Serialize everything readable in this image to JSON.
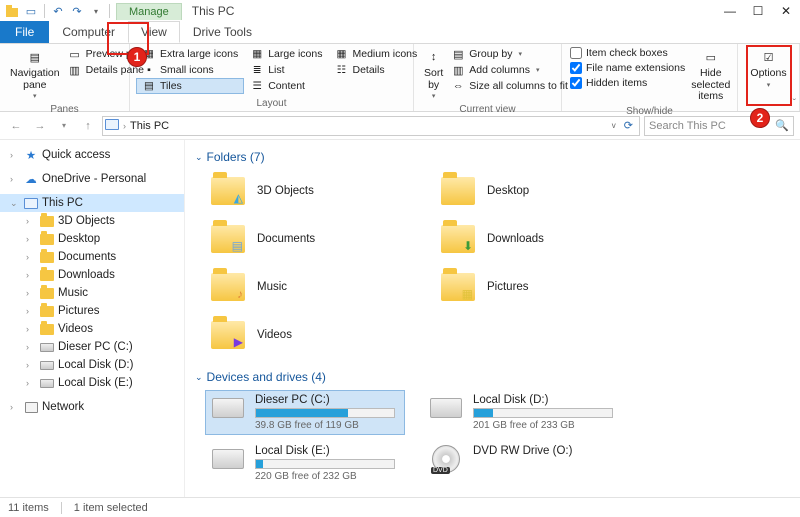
{
  "title": "This PC",
  "tabs": {
    "file": "File",
    "computer": "Computer",
    "view": "View",
    "drivetools": "Drive Tools",
    "manage": "Manage"
  },
  "ribbon": {
    "panes": {
      "nav": "Navigation pane",
      "preview": "Preview pane",
      "details": "Details pane",
      "label": "Panes"
    },
    "layout": {
      "xl": "Extra large icons",
      "lg": "Large icons",
      "md": "Medium icons",
      "sm": "Small icons",
      "list": "List",
      "det": "Details",
      "tiles": "Tiles",
      "content": "Content",
      "label": "Layout"
    },
    "view": {
      "sort": "Sort by",
      "group": "Group by",
      "addcols": "Add columns",
      "sizecols": "Size all columns to fit",
      "label": "Current view"
    },
    "showhide": {
      "itemchk": "Item check boxes",
      "ext": "File name extensions",
      "hidden": "Hidden items",
      "hidesel": "Hide selected items",
      "label": "Show/hide"
    },
    "options": "Options"
  },
  "addr": {
    "location": "This PC",
    "search_ph": "Search This PC"
  },
  "tree": {
    "quick": "Quick access",
    "onedrive": "OneDrive - Personal",
    "thispc": "This PC",
    "children": [
      "3D Objects",
      "Desktop",
      "Documents",
      "Downloads",
      "Music",
      "Pictures",
      "Videos",
      "Dieser PC (C:)",
      "Local Disk (D:)",
      "Local Disk (E:)"
    ],
    "network": "Network"
  },
  "sections": {
    "folders_h": "Folders (7)",
    "folders": [
      "3D Objects",
      "Desktop",
      "Documents",
      "Downloads",
      "Music",
      "Pictures",
      "Videos"
    ],
    "drives_h": "Devices and drives (4)"
  },
  "drives": [
    {
      "name": "Dieser PC (C:)",
      "free": "39.8 GB free of 119 GB",
      "pct": 67,
      "sel": true,
      "type": "hdd"
    },
    {
      "name": "Local Disk (D:)",
      "free": "201 GB free of 233 GB",
      "pct": 14,
      "type": "hdd"
    },
    {
      "name": "Local Disk (E:)",
      "free": "220 GB free of 232 GB",
      "pct": 5,
      "type": "hdd"
    },
    {
      "name": "DVD RW Drive (O:)",
      "free": "",
      "pct": 0,
      "type": "dvd"
    }
  ],
  "status": {
    "items": "11 items",
    "selected": "1 item selected"
  },
  "badges": {
    "one": "1",
    "two": "2"
  }
}
